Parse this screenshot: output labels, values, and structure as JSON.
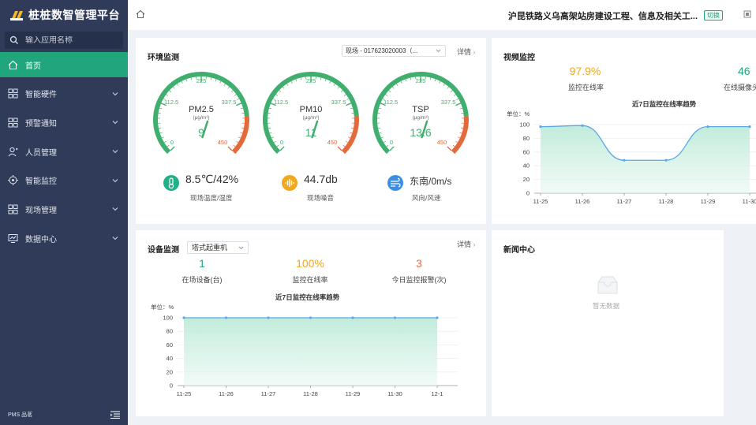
{
  "app": {
    "title": "桩桩数智管理平台",
    "footer_brand": "PMS 品茗"
  },
  "search": {
    "placeholder": "输入应用名称"
  },
  "sidebar": {
    "items": [
      {
        "label": "首页",
        "icon": "home-icon",
        "active": true
      },
      {
        "label": "智能硬件",
        "icon": "grid-icon",
        "has_children": true
      },
      {
        "label": "预警通知",
        "icon": "grid-icon",
        "has_children": true
      },
      {
        "label": "人员管理",
        "icon": "user-icon",
        "has_children": true
      },
      {
        "label": "智能监控",
        "icon": "target-icon",
        "has_children": true
      },
      {
        "label": "现场管理",
        "icon": "grid-icon",
        "has_children": true
      },
      {
        "label": "数据中心",
        "icon": "monitor-icon",
        "has_children": true
      }
    ]
  },
  "header": {
    "project": "沪昆铁路义乌高架站房建设工程、信息及相关工...",
    "switch_label": "切换"
  },
  "env": {
    "title": "环境监测",
    "select_value": "现场 - 017623020003（...",
    "detail": "详情",
    "gauges": [
      {
        "name": "PM2.5",
        "unit": "(μg/m³)",
        "value": "9",
        "numeric": 9
      },
      {
        "name": "PM10",
        "unit": "(μg/m³)",
        "value": "11",
        "numeric": 11
      },
      {
        "name": "TSP",
        "unit": "(μg/m³)",
        "value": "13.6",
        "numeric": 13.6
      }
    ],
    "gauge_ticks": [
      "0",
      "112.5",
      "225",
      "337.5",
      "450"
    ],
    "stats": [
      {
        "value": "8.5℃/42%",
        "label": "现场温度/湿度",
        "icon": "thermometer-icon",
        "color": "#21b08a"
      },
      {
        "value": "44.7db",
        "label": "现场噪音",
        "icon": "sound-wave-icon",
        "color": "#f0a81c"
      },
      {
        "value": "东南/0m/s",
        "label": "风向/风速",
        "icon": "wind-icon",
        "color": "#3a8ee6"
      }
    ]
  },
  "video": {
    "title": "视频监控",
    "online_rate": "97.9%",
    "online_rate_label": "监控在线率",
    "online_count": "46",
    "online_count_label": "在线摄像头",
    "chart_title": "近7日监控在线率趋势",
    "unit_label": "单位：%"
  },
  "device": {
    "title": "设备监测",
    "select_value": "塔式起重机",
    "detail": "详情",
    "stats": [
      {
        "value": "1",
        "label": "在场设备(台)",
        "color": "#21a57c"
      },
      {
        "value": "100%",
        "label": "监控在线率",
        "color": "#f0a81c"
      },
      {
        "value": "3",
        "label": "今日监控报警(次)",
        "color": "#e8704a"
      }
    ],
    "chart_title": "近7日监控在线率趋势",
    "unit_label": "单位：%"
  },
  "news": {
    "title": "新闻中心",
    "empty_text": "暂无数据"
  },
  "colors": {
    "accent": "#21a57c",
    "sidebar": "#2f3b58",
    "line": "#5aa9e6",
    "area": "#d2f1e6"
  },
  "chart_data": [
    {
      "type": "area",
      "title": "近7日监控在线率趋势",
      "ylabel": "单位：%",
      "categories": [
        "11-25",
        "11-26",
        "11-27",
        "11-28",
        "11-29",
        "11-30"
      ],
      "values": [
        97,
        98.5,
        48,
        48,
        97,
        97
      ],
      "ylim": [
        0,
        100
      ],
      "yticks": [
        0,
        20,
        40,
        60,
        80,
        100
      ]
    },
    {
      "type": "area",
      "title": "近7日监控在线率趋势",
      "ylabel": "单位：%",
      "categories": [
        "11-25",
        "11-26",
        "11-27",
        "11-28",
        "11-29",
        "11-30",
        "12-1"
      ],
      "values": [
        100,
        100,
        100,
        100,
        100,
        100,
        100
      ],
      "ylim": [
        0,
        100
      ],
      "yticks": [
        0,
        20,
        40,
        60,
        80,
        100
      ]
    }
  ]
}
